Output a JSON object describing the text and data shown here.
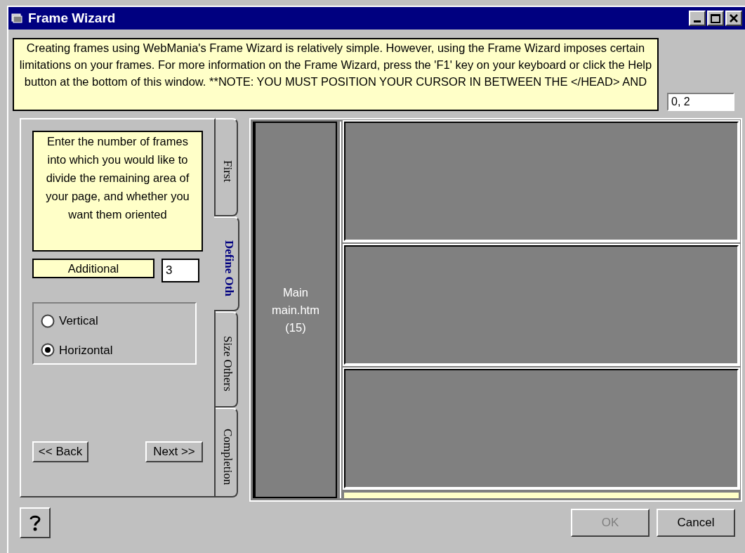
{
  "window": {
    "title": "Frame Wizard"
  },
  "info_text": "Creating frames using WebMania's Frame Wizard is relatively simple.  However, using the Frame Wizard imposes certain limitations on your frames.  For more information on the Frame Wizard, press the 'F1' key on your keyboard or click the Help button at the bottom of this window. **NOTE: YOU MUST POSITION YOUR CURSOR IN BETWEEN THE </HEAD> AND",
  "position_field": {
    "value": "0, 2"
  },
  "step_panel": {
    "instructions": "Enter the number of frames into which you would like to divide the remaining area of your page, and whether you want them oriented",
    "additional_label": "Additional",
    "additional_field": {
      "value": "3"
    },
    "orientation": [
      {
        "label": "Vertical",
        "selected": false
      },
      {
        "label": "Horizontal",
        "selected": true
      }
    ],
    "back_button": "<< Back",
    "next_button": "Next >>"
  },
  "tabs": [
    {
      "label": "First",
      "selected": false
    },
    {
      "label": "Define Oth",
      "selected": true
    },
    {
      "label": "Size Others",
      "selected": false
    },
    {
      "label": "Completion",
      "selected": false
    }
  ],
  "preview": {
    "main_frame": {
      "lines": [
        "Main",
        "main.htm",
        "(15)"
      ]
    }
  },
  "buttons": [
    {
      "label": "OK",
      "disabled": true
    },
    {
      "label": "Cancel",
      "disabled": false
    }
  ]
}
